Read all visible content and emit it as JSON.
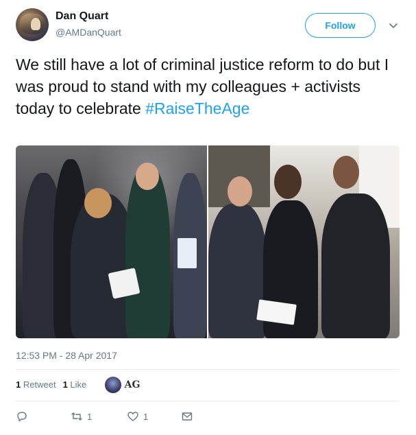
{
  "author": {
    "name": "Dan Quart",
    "handle": "@AMDanQuart"
  },
  "header": {
    "follow_label": "Follow"
  },
  "tweet": {
    "text": "We still have a lot of criminal justice reform to do but I was proud to stand with my colleagues + activists today to celebrate ",
    "hashtag": "#RaiseTheAge",
    "timestamp": "12:53 PM - 28 Apr 2017"
  },
  "stats": {
    "retweets_count": "1",
    "retweets_label": "Retweet",
    "likes_count": "1",
    "likes_label": "Like",
    "liker_initials": "AG"
  },
  "actions": {
    "reply_icon": "reply-icon",
    "retweet_count": "1",
    "like_count": "1",
    "message_icon": "envelope-icon"
  },
  "colors": {
    "accent": "#1da1f2",
    "muted": "#657786",
    "text": "#14171a"
  }
}
